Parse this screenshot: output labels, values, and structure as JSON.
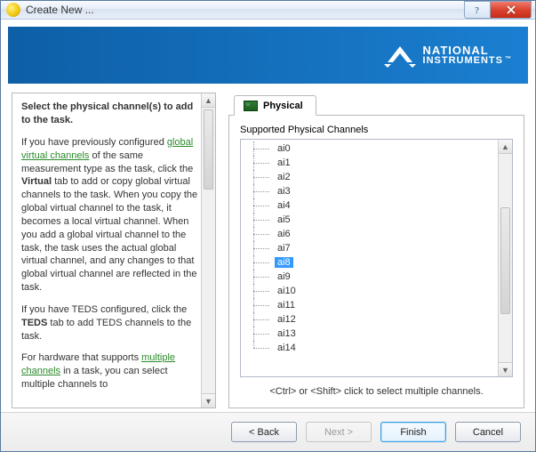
{
  "window": {
    "title": "Create New ..."
  },
  "banner": {
    "brand_line1": "NATIONAL",
    "brand_line2": "INSTRUMENTS"
  },
  "help": {
    "heading": "Select the physical channel(s) to add to the task.",
    "p1a": "If you have previously configured ",
    "p1_link": "global virtual channels",
    "p1b": " of the same measurement type as the task, click the ",
    "p1_bold1": "Virtual",
    "p1c": " tab to add or copy global virtual channels to the task. When you copy the global virtual channel to the task, it becomes a local virtual channel. When you add a global virtual channel to the task, the task uses the actual global virtual channel, and any changes to that global virtual channel are reflected in the task.",
    "p2a": "If you have TEDS configured, click the ",
    "p2_bold": "TEDS",
    "p2b": " tab to add TEDS channels to the task.",
    "p3a": "For hardware that supports ",
    "p3_link": "multiple channels",
    "p3b": " in a task, you can select multiple channels to"
  },
  "tabs": {
    "physical": "Physical"
  },
  "supported_label": "Supported Physical Channels",
  "channels": [
    "ai0",
    "ai1",
    "ai2",
    "ai3",
    "ai4",
    "ai5",
    "ai6",
    "ai7",
    "ai8",
    "ai9",
    "ai10",
    "ai11",
    "ai12",
    "ai13",
    "ai14"
  ],
  "selected_channel": "ai8",
  "hint": "<Ctrl> or <Shift> click to select multiple channels.",
  "buttons": {
    "back": "< Back",
    "next": "Next >",
    "finish": "Finish",
    "cancel": "Cancel"
  }
}
